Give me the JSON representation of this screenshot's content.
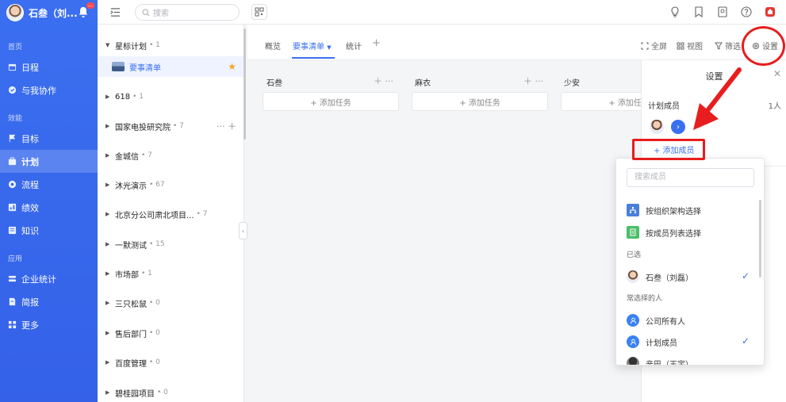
{
  "user": {
    "name": "石叁（刘...",
    "badge": "..."
  },
  "sidebar": {
    "sections": [
      {
        "label": "首页",
        "items": [
          {
            "label": "日程",
            "icon": "calendar-icon"
          },
          {
            "label": "与我协作",
            "icon": "collab-icon"
          }
        ]
      },
      {
        "label": "效能",
        "items": [
          {
            "label": "目标",
            "icon": "flag-icon"
          },
          {
            "label": "计划",
            "icon": "briefcase-icon",
            "active": true
          },
          {
            "label": "流程",
            "icon": "flow-icon"
          },
          {
            "label": "绩效",
            "icon": "chart-icon"
          },
          {
            "label": "知识",
            "icon": "book-icon"
          }
        ]
      },
      {
        "label": "应用",
        "items": [
          {
            "label": "企业统计",
            "icon": "stats-icon"
          },
          {
            "label": "简报",
            "icon": "report-icon"
          },
          {
            "label": "更多",
            "icon": "grid-icon"
          }
        ]
      }
    ]
  },
  "topbar": {
    "search_placeholder": "搜索"
  },
  "plans": {
    "starred": {
      "label": "星标计划",
      "count": "1",
      "sub": "要事清单"
    },
    "rows": [
      {
        "label": "618",
        "count": "1"
      },
      {
        "label": "国家电投研究院",
        "count": "7"
      },
      {
        "label": "金城信",
        "count": "7"
      },
      {
        "label": "沐光演示",
        "count": "67"
      },
      {
        "label": "北京分公司肃北项目...",
        "count": "7"
      },
      {
        "label": "一默测试",
        "count": "15"
      },
      {
        "label": "市场部",
        "count": "1"
      },
      {
        "label": "三只松鼠",
        "count": "0"
      },
      {
        "label": "售后部门",
        "count": "0"
      },
      {
        "label": "百度管理",
        "count": "0"
      },
      {
        "label": "碧桂园项目",
        "count": "0"
      }
    ]
  },
  "tabs": {
    "overview": "概览",
    "active": "要事清单",
    "stats": "统计",
    "add": "+"
  },
  "tools": {
    "fullscreen": "全屏",
    "view": "视图",
    "filter": "筛选",
    "settings": "设置"
  },
  "board": {
    "columns": [
      {
        "title": "石叁"
      },
      {
        "title": "麻衣"
      },
      {
        "title": "少安"
      }
    ],
    "add_task": "+ 添加任务"
  },
  "settings_panel": {
    "title": "设置",
    "members_label": "计划成员",
    "members_count": "1人",
    "add_member": "+ 添加成员"
  },
  "member_dropdown": {
    "search_placeholder": "搜索成员",
    "by_org": "按组织架构选择",
    "by_list": "按成员列表选择",
    "selected_label": "已选",
    "selected": [
      {
        "name": "石叁（刘磊）",
        "checked": true
      }
    ],
    "frequent_label": "常选择的人",
    "frequent": [
      {
        "name": "公司所有人",
        "checked": false
      },
      {
        "name": "计划成员",
        "checked": true
      },
      {
        "name": "辛巴（王宇）",
        "checked": false
      }
    ]
  },
  "colors": {
    "accent": "#3a6ff0",
    "sidebar": "#3461e8",
    "annotation": "#e81d1d"
  }
}
